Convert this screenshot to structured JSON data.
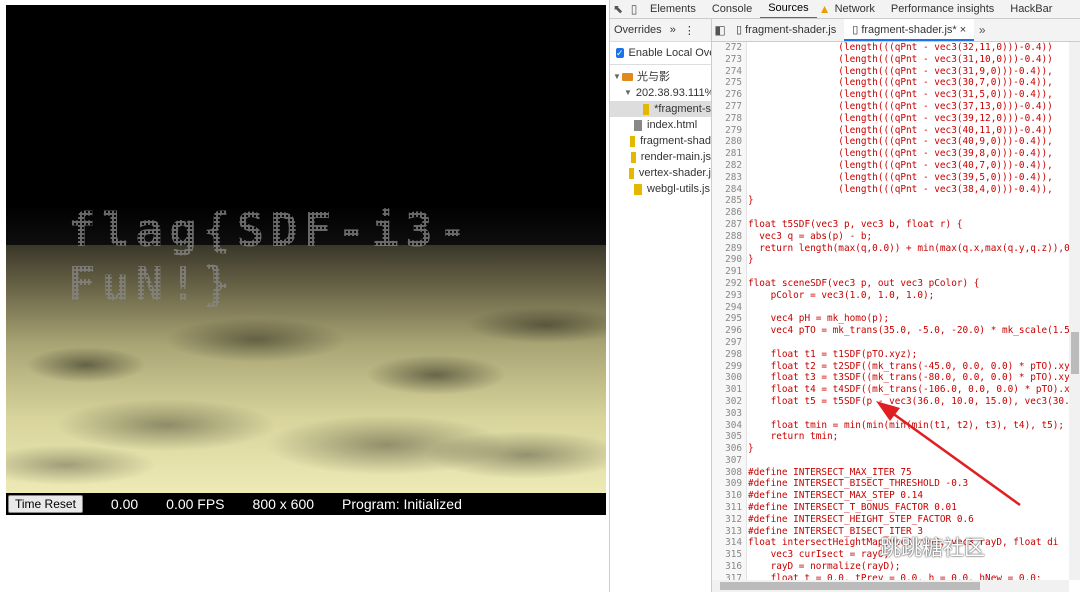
{
  "canvas": {
    "flag_text": "flag{SDF-i3-FuN!}",
    "status": {
      "reset_button": "Time Reset",
      "time": "0.00",
      "fps": "0.00 FPS",
      "resolution": "800 x 600",
      "program": "Program: Initialized"
    }
  },
  "devtools": {
    "tabs": [
      "Elements",
      "Console",
      "Sources",
      "Network",
      "Performance insights",
      "HackBar"
    ],
    "active_tab": "Sources",
    "left_pane": {
      "header": "Overrides",
      "enable_label": "Enable Local Over",
      "tree": [
        {
          "label": "光与影",
          "kind": "folder",
          "indent": 0
        },
        {
          "label": "202.38.93.111%",
          "kind": "folder",
          "indent": 1
        },
        {
          "label": "*fragment-s",
          "kind": "js",
          "indent": 2
        },
        {
          "label": "index.html",
          "kind": "html",
          "indent": 1
        },
        {
          "label": "fragment-shad",
          "kind": "js",
          "indent": 1
        },
        {
          "label": "render-main.js",
          "kind": "js",
          "indent": 1
        },
        {
          "label": "vertex-shader.j",
          "kind": "js",
          "indent": 1
        },
        {
          "label": "webgl-utils.js",
          "kind": "js",
          "indent": 1
        }
      ]
    },
    "file_tabs": [
      "fragment-shader.js",
      "fragment-shader.js*"
    ],
    "code_lines": [
      {
        "n": "272",
        "t": "                (length(((qPnt - vec3(32,11,0)))-0.4))"
      },
      {
        "n": "273",
        "t": "                (length(((qPnt - vec3(31,10,0)))-0.4))"
      },
      {
        "n": "274",
        "t": "                (length(((qPnt - vec3(31,9,0)))-0.4)),"
      },
      {
        "n": "275",
        "t": "                (length(((qPnt - vec3(30,7,0)))-0.4)),"
      },
      {
        "n": "276",
        "t": "                (length(((qPnt - vec3(31,5,0)))-0.4)),"
      },
      {
        "n": "277",
        "t": "                (length(((qPnt - vec3(37,13,0)))-0.4))"
      },
      {
        "n": "278",
        "t": "                (length(((qPnt - vec3(39,12,0)))-0.4))"
      },
      {
        "n": "279",
        "t": "                (length(((qPnt - vec3(40,11,0)))-0.4))"
      },
      {
        "n": "280",
        "t": "                (length(((qPnt - vec3(40,9,0)))-0.4)),"
      },
      {
        "n": "281",
        "t": "                (length(((qPnt - vec3(39,8,0)))-0.4)),"
      },
      {
        "n": "282",
        "t": "                (length(((qPnt - vec3(40,7,0)))-0.4)),"
      },
      {
        "n": "283",
        "t": "                (length(((qPnt - vec3(39,5,0)))-0.4)),"
      },
      {
        "n": "284",
        "t": "                (length(((qPnt - vec3(38,4,0)))-0.4)),"
      },
      {
        "n": "285",
        "t": "}"
      },
      {
        "n": "286",
        "t": ""
      },
      {
        "n": "287",
        "t": "float t5SDF(vec3 p, vec3 b, float r) {"
      },
      {
        "n": "288",
        "t": "  vec3 q = abs(p) - b;"
      },
      {
        "n": "289",
        "t": "  return length(max(q,0.0)) + min(max(q.x,max(q.y,q.z)),0.0"
      },
      {
        "n": "290",
        "t": "}"
      },
      {
        "n": "291",
        "t": ""
      },
      {
        "n": "292",
        "t": "float sceneSDF(vec3 p, out vec3 pColor) {"
      },
      {
        "n": "293",
        "t": "    pColor = vec3(1.0, 1.0, 1.0);"
      },
      {
        "n": "294",
        "t": ""
      },
      {
        "n": "295",
        "t": "    vec4 pH = mk_homo(p);"
      },
      {
        "n": "296",
        "t": "    vec4 pTO = mk_trans(35.0, -5.0, -20.0) * mk_scale(1.5,"
      },
      {
        "n": "297",
        "t": ""
      },
      {
        "n": "298",
        "t": "    float t1 = t1SDF(pTO.xyz);"
      },
      {
        "n": "299",
        "t": "    float t2 = t2SDF((mk_trans(-45.0, 0.0, 0.0) * pTO).xyz)"
      },
      {
        "n": "300",
        "t": "    float t3 = t3SDF((mk_trans(-80.0, 0.0, 0.0) * pTO).xyz)"
      },
      {
        "n": "301",
        "t": "    float t4 = t4SDF((mk_trans(-106.0, 0.0, 0.0) * pTO).xyz"
      },
      {
        "n": "302",
        "t": "    float t5 = t5SDF(p - vec3(36.0, 10.0, 15.0), vec3(30.0,"
      },
      {
        "n": "303",
        "t": ""
      },
      {
        "n": "304",
        "t": "    float tmin = min(min(min(min(t1, t2), t3), t4), t5);"
      },
      {
        "n": "305",
        "t": "    return tmin;"
      },
      {
        "n": "306",
        "t": "}"
      },
      {
        "n": "307",
        "t": ""
      },
      {
        "n": "308",
        "t": "#define INTERSECT_MAX_ITER 75"
      },
      {
        "n": "309",
        "t": "#define INTERSECT_BISECT_THRESHOLD -0.3"
      },
      {
        "n": "310",
        "t": "#define INTERSECT_MAX_STEP 0.14"
      },
      {
        "n": "311",
        "t": "#define INTERSECT_T_BONUS_FACTOR 0.01"
      },
      {
        "n": "312",
        "t": "#define INTERSECT_HEIGHT_STEP_FACTOR 0.6"
      },
      {
        "n": "313",
        "t": "#define INTERSECT_BISECT_ITER 3"
      },
      {
        "n": "314",
        "t": "float intersectHeightMap(vec3 rayO, vec3 rayD, float di"
      },
      {
        "n": "315",
        "t": "    vec3 curIsect = rayO;"
      },
      {
        "n": "316",
        "t": "    rayD = normalize(rayD);"
      },
      {
        "n": "317",
        "t": "    float t = 0.0, tPrev = 0.0, h = 0.0, hNew = 0.0;"
      }
    ]
  },
  "watermark": "跳跳糖社区"
}
